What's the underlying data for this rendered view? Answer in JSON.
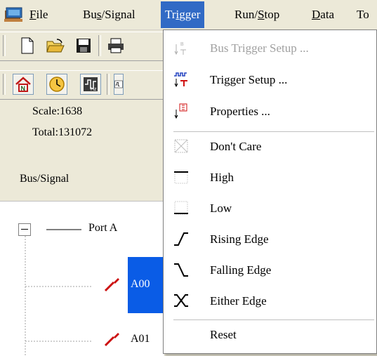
{
  "menubar": {
    "items": [
      {
        "label": "File",
        "mnemonic": "F",
        "rest": "ile"
      },
      {
        "label": "Bus/Signal",
        "pre": "Bu",
        "mnemonic": "s",
        "rest": "/Signal"
      },
      {
        "label": "Trigger",
        "pre": "Tr",
        "mnemonic": "i",
        "rest": "gger"
      },
      {
        "label": "Run/Stop",
        "pre": "Run/",
        "mnemonic": "S",
        "rest": "top"
      },
      {
        "label": "Data",
        "mnemonic": "D",
        "rest": "ata"
      },
      {
        "label": "To"
      }
    ],
    "active": "Trigger"
  },
  "info": {
    "scale": "Scale:1638",
    "total": "Total:131072"
  },
  "tree": {
    "header": "Bus/Signal",
    "port": "Port A",
    "signals": [
      "A00",
      "A01"
    ]
  },
  "trigger_menu": {
    "items": [
      {
        "label": "Bus Trigger Setup ...",
        "disabled": true,
        "icon": "bus-trigger-icon"
      },
      {
        "label": "Trigger Setup ...",
        "disabled": false,
        "icon": "trigger-setup-icon"
      },
      {
        "label": "Properties ...",
        "disabled": false,
        "icon": "properties-icon"
      },
      {
        "label": "Don't Care",
        "disabled": false,
        "icon": "dont-care-icon"
      },
      {
        "label": "High",
        "disabled": false,
        "icon": "high-icon"
      },
      {
        "label": "Low",
        "disabled": false,
        "icon": "low-icon"
      },
      {
        "label": "Rising Edge",
        "disabled": false,
        "icon": "rising-edge-icon"
      },
      {
        "label": "Falling Edge",
        "disabled": false,
        "icon": "falling-edge-icon"
      },
      {
        "label": "Either Edge",
        "disabled": false,
        "icon": "either-edge-icon"
      },
      {
        "label": "Reset",
        "disabled": false
      }
    ]
  },
  "colors": {
    "menu_highlight": "#316ac5",
    "selection": "#0a5ce6",
    "probe": "#cc1010"
  }
}
